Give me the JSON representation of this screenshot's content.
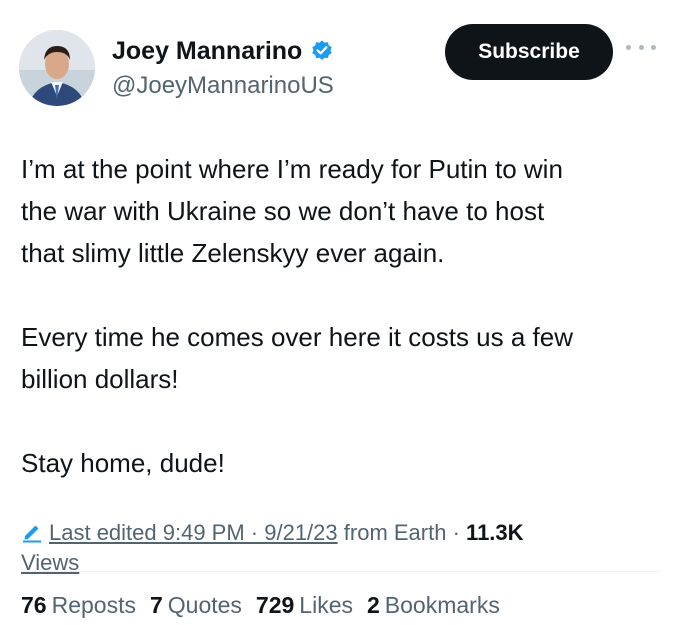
{
  "author": {
    "name": "Joey Mannarino",
    "handle": "@JoeyMannarinoUS",
    "verified_color": "#1d9bf0"
  },
  "header": {
    "subscribe_label": "Subscribe",
    "more_icon": "more-horizontal-icon"
  },
  "tweet": {
    "paragraphs": [
      "I’m at the point where I’m ready for Putin to win\nthe war with Ukraine so we don’t have to host\nthat slimy little Zelenskyy ever again.",
      "Every time he comes over here it costs us a few\nbillion dollars!",
      "Stay home, dude!"
    ]
  },
  "meta": {
    "edit_icon": "edit-pencil-icon",
    "last_edited": "Last edited 9:49 PM · 9/21/23",
    "from": "from Earth",
    "separator": "·",
    "views_count": "11.3K",
    "views_label": "Views"
  },
  "stats": [
    {
      "count": "76",
      "label": "Reposts"
    },
    {
      "count": "7",
      "label": "Quotes"
    },
    {
      "count": "729",
      "label": "Likes"
    },
    {
      "count": "2",
      "label": "Bookmarks"
    }
  ],
  "colors": {
    "text": "#0f1419",
    "secondary": "#536471",
    "accent": "#1d9bf0",
    "button_bg": "#0f1419"
  }
}
